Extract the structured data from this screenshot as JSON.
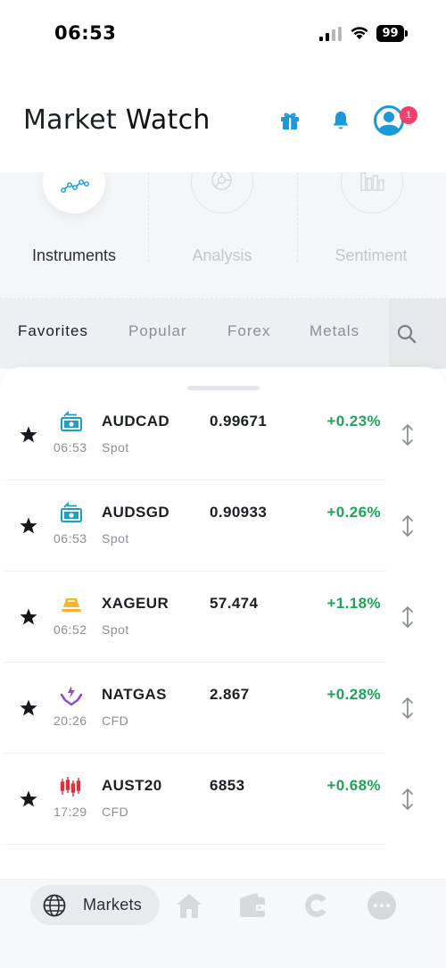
{
  "status_bar": {
    "time": "06:53",
    "battery": "99"
  },
  "header": {
    "title_light": "Market",
    "title_bold": "Watch",
    "notification_count": "1"
  },
  "sections": [
    {
      "label": "Instruments",
      "active": true
    },
    {
      "label": "Analysis",
      "active": false
    },
    {
      "label": "Sentiment",
      "active": false
    }
  ],
  "tabs": [
    {
      "label": "Favorites",
      "active": true
    },
    {
      "label": "Popular",
      "active": false
    },
    {
      "label": "Forex",
      "active": false
    },
    {
      "label": "Metals",
      "active": false
    }
  ],
  "instruments": [
    {
      "symbol": "AUDCAD",
      "price": "0.99671",
      "change": "+0.23%",
      "time": "06:53",
      "type": "Spot",
      "icon": "currency-exchange-icon"
    },
    {
      "symbol": "AUDSGD",
      "price": "0.90933",
      "change": "+0.26%",
      "time": "06:53",
      "type": "Spot",
      "icon": "currency-exchange-icon"
    },
    {
      "symbol": "XAGEUR",
      "price": "57.474",
      "change": "+1.18%",
      "time": "06:52",
      "type": "Spot",
      "icon": "metal-bar-icon"
    },
    {
      "symbol": "NATGAS",
      "price": "2.867",
      "change": "+0.28%",
      "time": "20:26",
      "type": "CFD",
      "icon": "energy-hand-icon"
    },
    {
      "symbol": "AUST20",
      "price": "6853",
      "change": "+0.68%",
      "time": "17:29",
      "type": "CFD",
      "icon": "candlestick-icon"
    }
  ],
  "bottom_nav": {
    "active_label": "Markets",
    "items": [
      "globe-icon",
      "home-icon",
      "wallet-icon",
      "coin-icon",
      "more-icon"
    ]
  },
  "colors": {
    "accent_blue": "#1a9ad9",
    "positive_green": "#1fa45a",
    "badge_pink": "#f0416c",
    "gold": "#f2b930",
    "purple": "#8d4fd8",
    "red": "#d9333f",
    "teal": "#1aa0c8"
  }
}
